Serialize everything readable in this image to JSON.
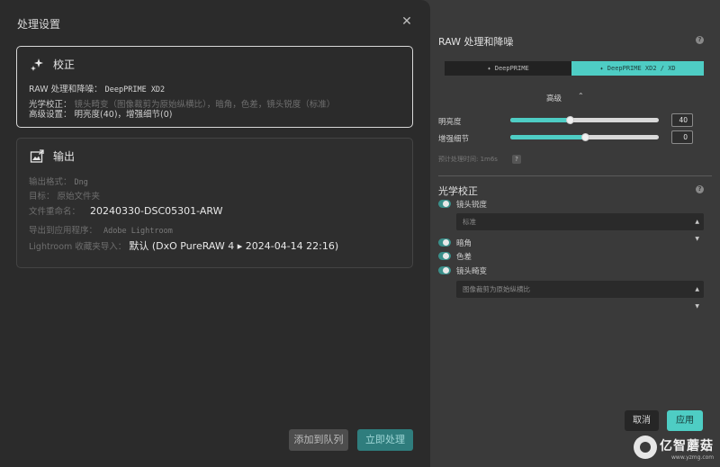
{
  "dialog": {
    "title": "处理设置",
    "close_glyph": "✕",
    "correction": {
      "title": "校正",
      "icon": "sparkle-icon",
      "raw_label": "RAW 处理和降噪：",
      "raw_value": "DeepPRIME XD2",
      "optical_label": "光学校正：",
      "optical_value": "镜头畸变（图像裁剪为原始纵横比），暗角，色差，镜头锐度（标准）",
      "advanced_label": "高级设置：",
      "advanced_value": "明亮度(40)，增强细节(0)"
    },
    "output": {
      "title": "输出",
      "icon": "image-export-icon",
      "format_label": "输出格式：",
      "format_value": "Dng",
      "target_label": "目标：",
      "target_value": "原始文件夹",
      "rename_label": "文件重命名：",
      "rename_value": "20240330-DSC05301-ARW",
      "export_label": "导出到应用程序：",
      "export_value": "Adobe Lightroom",
      "lr_label": "Lightroom 收藏夹导入：",
      "lr_value": "默认 (DxO PureRAW 4 ▸ 2024-04-14 22:16)"
    },
    "buttons": {
      "queue": "添加到队列",
      "process": "立即处理"
    }
  },
  "panel": {
    "title": "RAW 处理和降噪",
    "help_glyph": "?",
    "modes": {
      "deepprime": "✦ DeepPRIME",
      "deepprime_xd2": "✦ DeepPRIME XD2 / XD"
    },
    "advanced": "高级",
    "advanced_chevron": "⌃",
    "sliders": [
      {
        "label": "明亮度",
        "value": "40",
        "level": 0.4
      },
      {
        "label": "增强细节",
        "value": "0",
        "level": 0.5
      }
    ],
    "estimate": "预计处理时间: 1m6s",
    "optical": {
      "title": "光学校正",
      "sharpness_label": "镜头锐度",
      "sharpness_option": "标准",
      "vignetting_label": "暗角",
      "chromatic_label": "色差",
      "distortion_label": "镜头畸变",
      "distortion_option": "图像裁剪为原始纵横比"
    },
    "buttons": {
      "cancel": "取消",
      "apply": "应用"
    },
    "accent": "#4ecdc4"
  },
  "watermark": {
    "brand": "亿智蘑菇",
    "url": "www.yzmg.com"
  }
}
